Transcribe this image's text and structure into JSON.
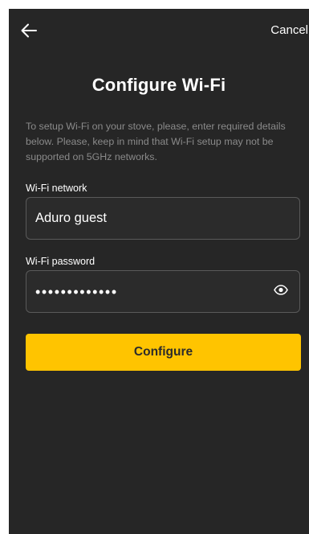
{
  "topbar": {
    "back_icon": "arrow-left-icon",
    "cancel_label": "Cancel"
  },
  "page": {
    "title": "Configure Wi-Fi",
    "description": "To setup Wi-Fi on your stove, please, enter required details below. Please, keep in mind that Wi-Fi setup may not be supported on 5GHz networks."
  },
  "form": {
    "network_label": "Wi-Fi network",
    "network_value": "Aduro guest",
    "password_label": "Wi-Fi password",
    "password_masked": "•••••••••••••",
    "password_toggle_icon": "eye-icon"
  },
  "actions": {
    "configure_label": "Configure"
  },
  "colors": {
    "background": "#262626",
    "accent": "#ffc400",
    "muted_text": "#8a8a8a"
  }
}
